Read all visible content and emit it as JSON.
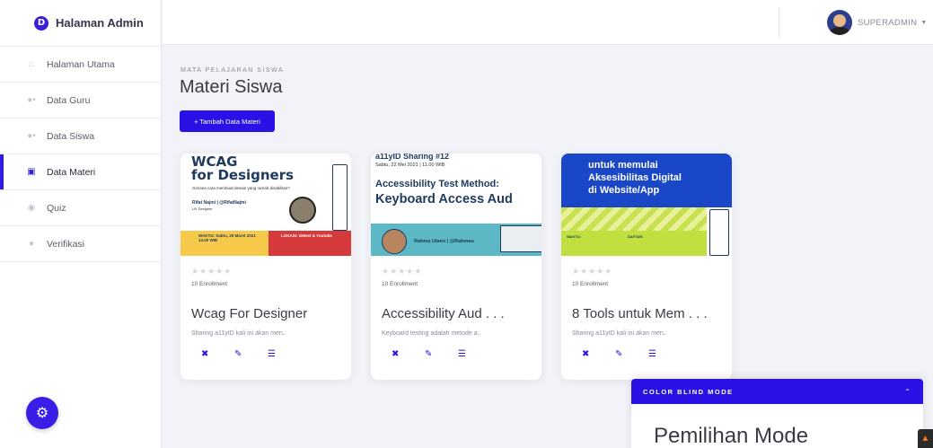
{
  "sidebar": {
    "brand": "Halaman Admin",
    "brand_logo_letter": "D",
    "items": [
      {
        "label": "Halaman Utama",
        "icon": "home-icon",
        "active": false
      },
      {
        "label": "Data Guru",
        "icon": "users-icon",
        "active": false
      },
      {
        "label": "Data Siswa",
        "icon": "users-icon",
        "active": false
      },
      {
        "label": "Data Materi",
        "icon": "chalkboard-icon",
        "active": true
      },
      {
        "label": "Quiz",
        "icon": "eye-icon",
        "active": false
      },
      {
        "label": "Verifikasi",
        "icon": "circle-icon",
        "active": false
      }
    ]
  },
  "topbar": {
    "user_name": "SUPERADMIN"
  },
  "main": {
    "eyebrow": "MATA PELAJARAN SISWA",
    "title": "Materi Siswa",
    "add_button": "+ Tambah Data Materi"
  },
  "cards": [
    {
      "stars": "★★★★★",
      "enrollment": "10 Enrollment",
      "title": "Wcag For Designer",
      "description": "Sharing a11yID kali ini akan men..",
      "thumb": {
        "heading_line1": "WCAG",
        "heading_line2": "for Designers",
        "subtitle": "Gimana cara membuat desain yang ramah disabilitas?",
        "speaker": "Rifat Najmi | @RifatNajmi",
        "role": "UX Designer",
        "time_label": "WAKTU: Sabtu, 20 Maret 2021 14.00 WIB",
        "location_label": "LOKASI: GMeet & Youtube"
      }
    },
    {
      "stars": "★★★★★",
      "enrollment": "10 Enrollment",
      "title": "Accessibility Aud . . .",
      "description": "Keyboard testing adalah metode a..",
      "thumb": {
        "heading_top": "a11yID Sharing #12",
        "date": "Sabtu, 22 Mei 2021 | 11.00 WIB",
        "heading_line1": "Accessibility Test Method:",
        "heading_line2": "Keyboard Access Aud",
        "speaker": "Rahma Utami | @Rahmau"
      }
    },
    {
      "stars": "★★★★★",
      "enrollment": "10 Enrollment",
      "title": "8 Tools untuk Mem . . .",
      "description": "Sharing a11yID kali ini akan men..",
      "thumb": {
        "heading_line1": "untuk memulai",
        "heading_line2": "Aksesibilitas Digital",
        "heading_line3": "di Website/App",
        "time_label": "WAKTU:",
        "register_label": "DAFTAR:"
      }
    }
  ],
  "color_blind_panel": {
    "header": "COLOR BLIND MODE",
    "title": "Pemilihan Mode"
  },
  "colors": {
    "primary": "#2a12e6",
    "sidebar_bg": "#ffffff",
    "page_bg": "#f2f3f8"
  }
}
